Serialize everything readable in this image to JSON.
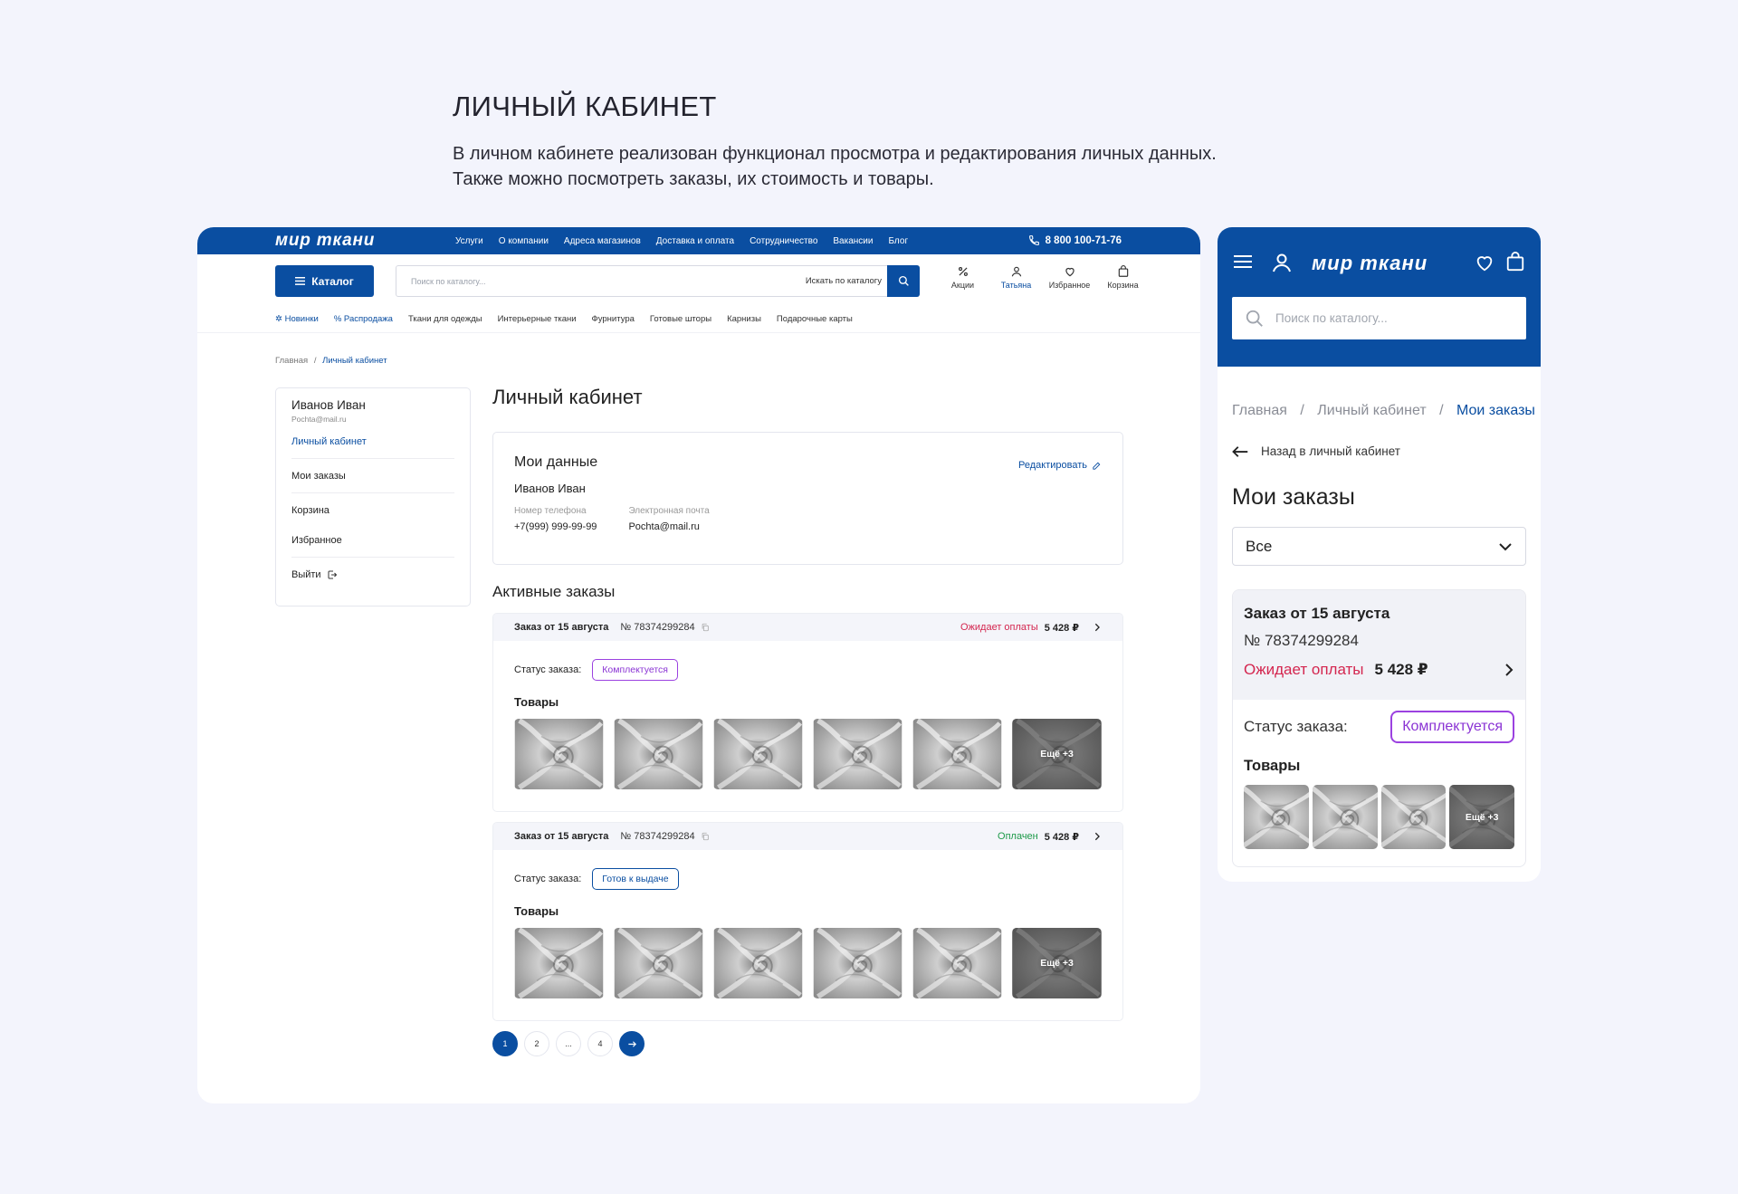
{
  "intro": {
    "title": "ЛИЧНЫЙ КАБИНЕТ",
    "line1": "В личном кабинете реализован функционал просмотра и редактирования личных данных.",
    "line2": "Также можно посмотреть заказы, их стоимость и товары."
  },
  "brand": {
    "logo": "мир ткани",
    "primary": "#0a4ea1",
    "accent_red": "#d4264f",
    "accent_green": "#1e9a4a",
    "accent_violet": "#8a33d4"
  },
  "desktop": {
    "topnav": [
      "Услуги",
      "О компании",
      "Адреса магазинов",
      "Доставка и оплата",
      "Сотрудничество",
      "Вакансии",
      "Блог"
    ],
    "phone": "8 800 100-71-76",
    "catalog_label": "Каталог",
    "search_placeholder": "Поиск по каталогу...",
    "search_scope": "Искать по каталогу",
    "header_icons": [
      {
        "label": "Акции",
        "icon": "percent-icon"
      },
      {
        "label": "Татьяна",
        "icon": "user-icon"
      },
      {
        "label": "Избранное",
        "icon": "heart-icon"
      },
      {
        "label": "Корзина",
        "icon": "bag-icon"
      }
    ],
    "menu": [
      "Новинки",
      "Распродажа",
      "Ткани для одежды",
      "Интерьерные ткани",
      "Фурнитура",
      "Готовые шторы",
      "Карнизы",
      "Подарочные карты"
    ],
    "breadcrumb": [
      "Главная",
      "/",
      "Личный кабинет"
    ],
    "sidebar": {
      "name": "Иванов Иван",
      "email": "Pochta@mail.ru",
      "items": [
        "Личный кабинет",
        "Мои заказы",
        "Корзина",
        "Избранное",
        "Выйти"
      ]
    },
    "page_title": "Личный кабинет",
    "my_data": {
      "title": "Мои данные",
      "edit": "Редактировать",
      "name": "Иванов Иван",
      "phone_label": "Номер телефона",
      "phone": "+7(999) 999-99-99",
      "email_label": "Электронная почта",
      "email": "Pochta@mail.ru"
    },
    "active_orders_title": "Активные заказы",
    "orders": [
      {
        "date": "Заказ от 15 августа",
        "number": "№ 78374299284",
        "status": "Ожидает оплаты",
        "sum": "5 428 ₽",
        "state_label": "Статус заказа:",
        "state": "Комплектуется",
        "goods": "Товары",
        "more": "Ещё +3"
      },
      {
        "date": "Заказ от 15 августа",
        "number": "№ 78374299284",
        "status": "Оплачен",
        "sum": "5 428 ₽",
        "state_label": "Статус заказа:",
        "state": "Готов к выдаче",
        "goods": "Товары",
        "more": "Ещё +3"
      }
    ],
    "pager": [
      "1",
      "2",
      "...",
      "4"
    ]
  },
  "mobile": {
    "search_placeholder": "Поиск по каталогу...",
    "breadcrumb": [
      "Главная",
      "/",
      "Личный кабинет",
      "/",
      "Мои заказы"
    ],
    "back": "Назад в личный кабинет",
    "title": "Мои заказы",
    "filter": "Все",
    "order": {
      "date": "Заказ от 15 августа",
      "number": "№ 78374299284",
      "status": "Ожидает оплаты",
      "sum": "5 428 ₽",
      "state_label": "Статус заказа:",
      "state": "Комплектуется",
      "goods": "Товары",
      "more": "Ещё +3"
    }
  }
}
